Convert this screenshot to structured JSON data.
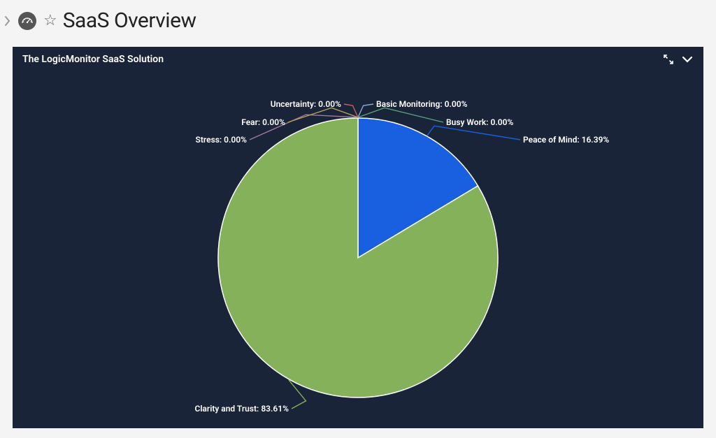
{
  "header": {
    "title": "SaaS Overview"
  },
  "panel": {
    "title": "The LogicMonitor SaaS Solution"
  },
  "chart_data": {
    "type": "pie",
    "series": [
      {
        "name": "Peace of Mind",
        "value": 16.39,
        "label": "Peace of Mind: 16.39%",
        "color": "#1860e0"
      },
      {
        "name": "Clarity and Trust",
        "value": 83.61,
        "label": "Clarity and Trust: 83.61%",
        "color": "#86b15b"
      },
      {
        "name": "Stress",
        "value": 0.0,
        "label": "Stress: 0.00%",
        "color": "#a07aa0"
      },
      {
        "name": "Fear",
        "value": 0.0,
        "label": "Fear: 0.00%",
        "color": "#b5a05a"
      },
      {
        "name": "Uncertainty",
        "value": 0.0,
        "label": "Uncertainty: 0.00%",
        "color": "#c06060"
      },
      {
        "name": "Basic Monitoring",
        "value": 0.0,
        "label": "Basic Monitoring: 0.00%",
        "color": "#8aa8d8"
      },
      {
        "name": "Busy Work",
        "value": 0.0,
        "label": "Busy Work: 0.00%",
        "color": "#5aa080"
      }
    ]
  }
}
